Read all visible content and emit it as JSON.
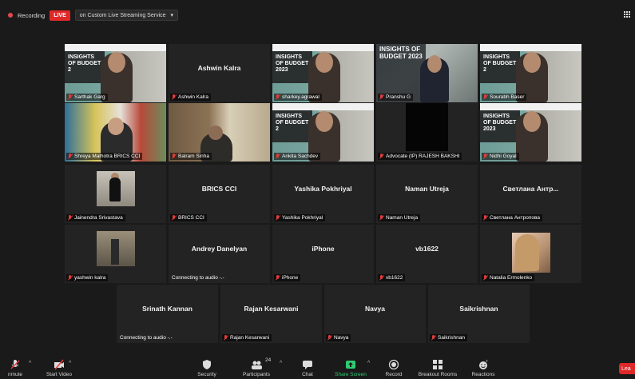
{
  "topbar": {
    "recording_label": "Recording",
    "live_badge": "LIVE",
    "stream_target": "on Custom Live Streaming Service",
    "stream_caret": "▾"
  },
  "tiles": [
    {
      "id": "t1",
      "type": "budget",
      "video_text": "INSIGHTS OF BUDGET 2",
      "label": "Sarthak Garg"
    },
    {
      "id": "t2",
      "type": "name",
      "center": "Ashwin Kalra",
      "label": "Ashwin Kalra"
    },
    {
      "id": "t3",
      "type": "budget",
      "video_text": "INSIGHTS OF BUDGET 2023",
      "label": "sharkey.agrawal"
    },
    {
      "id": "t4",
      "type": "insight",
      "video_text": "INSIGHTS OF BUDGET 2023",
      "label": "Pranshu G"
    },
    {
      "id": "t5",
      "type": "budget",
      "video_text": "INSIGHTS OF BUDGET 2",
      "label": "Sourabh Baser"
    },
    {
      "id": "t6",
      "type": "flags",
      "label": "Shreya Malhotra BRICS CCI",
      "active": true
    },
    {
      "id": "t7",
      "type": "room",
      "label": "Balram Sinha"
    },
    {
      "id": "t8",
      "type": "budget",
      "video_text": "INSIGHTS OF BUDGET 2",
      "label": "Ankita Sachdev"
    },
    {
      "id": "t9",
      "type": "dark",
      "label": "Advocate (IP) RAJESH BAKSHI"
    },
    {
      "id": "t10",
      "type": "budget",
      "video_text": "INSIGHTS OF BUDGET 2023",
      "label": "Nidhi Goyal"
    },
    {
      "id": "t11",
      "type": "gym",
      "label": "Jainendra Srivastava"
    },
    {
      "id": "t12",
      "type": "name",
      "center": "BRICS CCI",
      "label": "BRICS CCI"
    },
    {
      "id": "t13",
      "type": "name",
      "center": "Yashika Pokhriyal",
      "label": "Yashika Pokhriyal"
    },
    {
      "id": "t14",
      "type": "name",
      "center": "Naman Utreja",
      "label": "Naman Utreja"
    },
    {
      "id": "t15",
      "type": "name",
      "center": "Светлана Антр...",
      "label": "Светлана Антропова"
    },
    {
      "id": "t16",
      "type": "street",
      "label": "yashwin kalra"
    },
    {
      "id": "t17",
      "type": "name",
      "center": "Andrey Danelyan",
      "label": "Connecting to audio -.-",
      "plain": true
    },
    {
      "id": "t18",
      "type": "name",
      "center": "iPhone",
      "label": "iPhone"
    },
    {
      "id": "t19",
      "type": "name",
      "center": "vb1622",
      "label": "vb1622"
    },
    {
      "id": "t20",
      "type": "selfie",
      "label": "Natalia Ermolenko"
    },
    {
      "id": "t21",
      "type": "name",
      "center": "Srinath Kannan",
      "label": "Connecting to audio -.-",
      "plain": true
    },
    {
      "id": "t22",
      "type": "name",
      "center": "Rajan Kesarwani",
      "label": "Rajan Kesarwani"
    },
    {
      "id": "t23",
      "type": "name",
      "center": "Navya",
      "label": "Navya"
    },
    {
      "id": "t24",
      "type": "name",
      "center": "Saikrishnan",
      "label": "Saikrishnan"
    }
  ],
  "toolbar": {
    "unmute": "nmute",
    "start_video": "Start Video",
    "security": "Security",
    "participants": "Participants",
    "participants_count": "24",
    "chat": "Chat",
    "share_screen": "Share Screen",
    "record": "Record",
    "breakout": "Breakout Rooms",
    "reactions": "Reactions",
    "leave": "Lea"
  }
}
